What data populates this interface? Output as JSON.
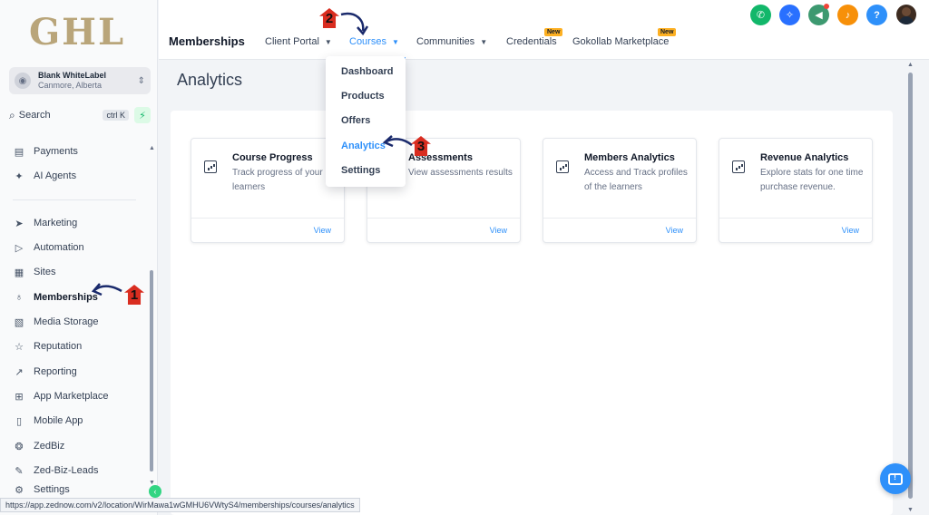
{
  "sidebar": {
    "logo": "GHL",
    "account": {
      "name": "Blank WhiteLabel",
      "location": "Canmore, Alberta"
    },
    "search": {
      "label": "Search",
      "shortcut": "ctrl K"
    },
    "items": [
      {
        "label": "Payments",
        "icon": "receipt-icon"
      },
      {
        "label": "AI Agents",
        "icon": "sparkle-icon"
      },
      {
        "label": "Marketing",
        "icon": "send-icon"
      },
      {
        "label": "Automation",
        "icon": "play-circle-icon"
      },
      {
        "label": "Sites",
        "icon": "layout-icon"
      },
      {
        "label": "Memberships",
        "icon": "award-icon"
      },
      {
        "label": "Media Storage",
        "icon": "image-icon"
      },
      {
        "label": "Reputation",
        "icon": "star-icon"
      },
      {
        "label": "Reporting",
        "icon": "trend-icon"
      },
      {
        "label": "App Marketplace",
        "icon": "grid-icon"
      },
      {
        "label": "Mobile App",
        "icon": "phone-icon"
      },
      {
        "label": "ZedBiz",
        "icon": "brain-icon"
      },
      {
        "label": "Zed-Biz-Leads",
        "icon": "wrench-icon"
      },
      {
        "label": "Settings",
        "icon": "gear-icon"
      }
    ]
  },
  "header": {
    "title": "Memberships",
    "tabs": [
      {
        "label": "Client Portal",
        "has_caret": true
      },
      {
        "label": "Courses",
        "has_caret": true,
        "selected": true
      },
      {
        "label": "Communities",
        "has_caret": true
      },
      {
        "label": "Credentials",
        "badge": "New"
      },
      {
        "label": "Gokollab Marketplace",
        "badge": "New"
      }
    ],
    "icons": [
      {
        "name": "phone-icon",
        "color": "#12b76a"
      },
      {
        "name": "sparkle-icon",
        "color": "#2970ff"
      },
      {
        "name": "megaphone-icon",
        "color": "#3d9970"
      },
      {
        "name": "bell-icon",
        "color": "#f79009"
      },
      {
        "name": "help-icon",
        "color": "#2e90fa"
      }
    ]
  },
  "dropdown": {
    "items": [
      "Dashboard",
      "Products",
      "Offers",
      "Analytics",
      "Settings"
    ],
    "selected": "Analytics"
  },
  "main": {
    "title": "Analytics",
    "cards": [
      {
        "title": "Course Progress",
        "description": "Track progress of your learners",
        "action": "View"
      },
      {
        "title": "Assessments",
        "description": "View assessments results",
        "action": "View"
      },
      {
        "title": "Members Analytics",
        "description": "Access and Track profiles of the learners",
        "action": "View"
      },
      {
        "title": "Revenue Analytics",
        "description": "Explore stats for one time purchase revenue.",
        "action": "View"
      }
    ]
  },
  "status_url": "https://app.zednow.com/v2/location/WirMawa1wGMHU6VWtyS4/memberships/courses/analytics",
  "annotations": [
    "1",
    "2",
    "3"
  ],
  "colors": {
    "accent": "#2e90fa",
    "annotation": "#d92d20",
    "badge": "#fdb022"
  }
}
